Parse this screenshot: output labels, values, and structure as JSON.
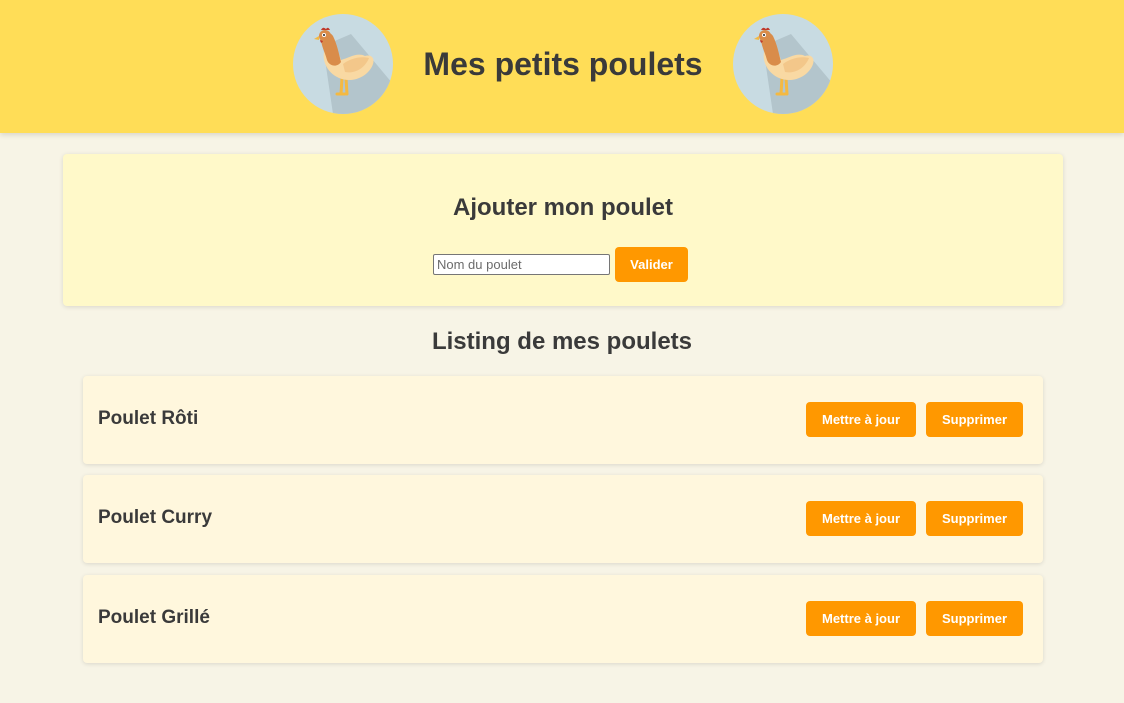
{
  "header": {
    "title": "Mes petits poulets",
    "logo_icon": "chicken-icon"
  },
  "add_form": {
    "title": "Ajouter mon poulet",
    "input_value": "",
    "input_placeholder": "Nom du poulet",
    "submit_label": "Valider"
  },
  "listing": {
    "title": "Listing de mes poulets",
    "update_label": "Mettre à jour",
    "delete_label": "Supprimer",
    "items": [
      {
        "name": "Poulet Rôti"
      },
      {
        "name": "Poulet Curry"
      },
      {
        "name": "Poulet Grillé"
      }
    ]
  },
  "colors": {
    "header_bg": "#ffdd57",
    "page_bg": "#f7f4e6",
    "form_card_bg": "#fff9c9",
    "item_card_bg": "#fff7dd",
    "button_bg": "#ff9800",
    "button_text": "#ffffff",
    "text": "#3a3a3a"
  }
}
